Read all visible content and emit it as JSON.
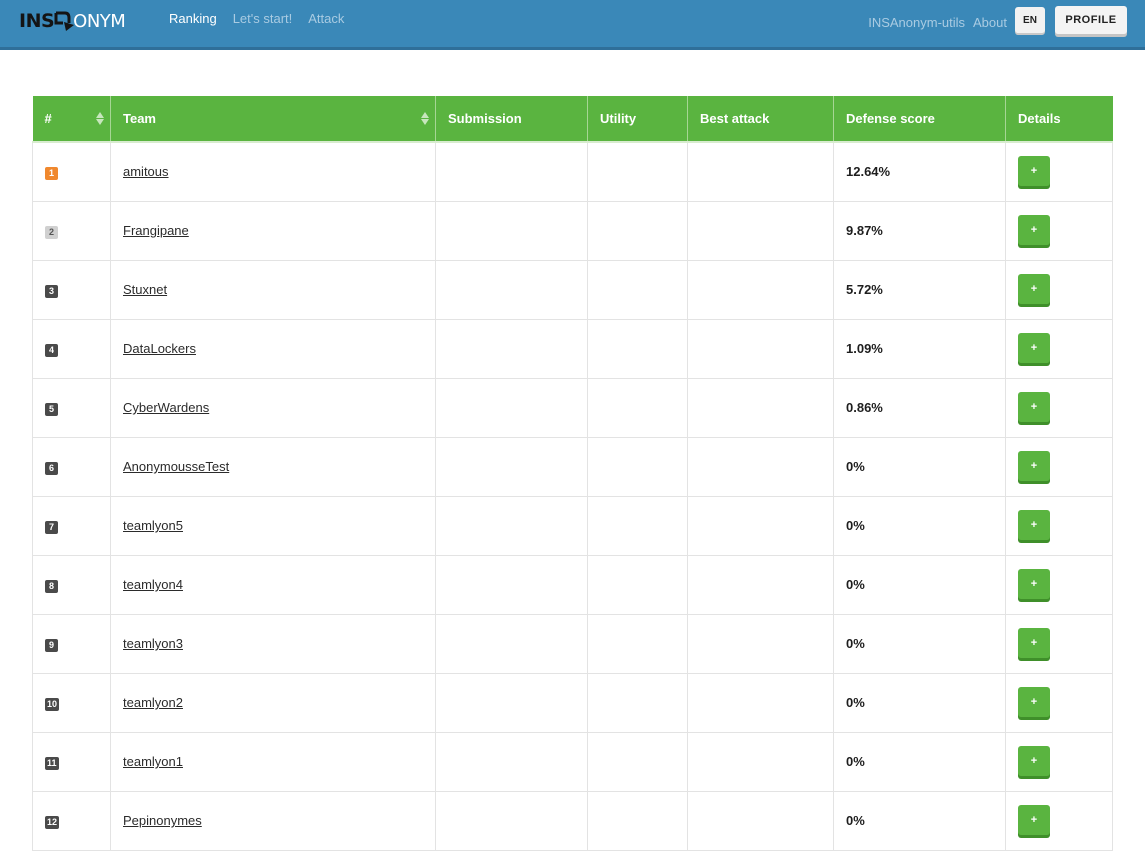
{
  "colors": {
    "navbar": "#3a88b8",
    "header_green": "#5ab440",
    "badge_gold": "#f0882e",
    "badge_silver": "#d0d0d0",
    "badge_dark": "#4a4a4a"
  },
  "brand": {
    "part1": "INS",
    "part2": "ONYM",
    "logo_icon": "arrow-logo-icon"
  },
  "nav": {
    "ranking": "Ranking",
    "lets_start": "Let's start!",
    "attack": "Attack",
    "utils": "INSAnonym-utils",
    "about": "About",
    "lang": "EN",
    "profile": "PROFILE"
  },
  "table": {
    "headers": {
      "rank": "#",
      "team": "Team",
      "submission": "Submission",
      "utility": "Utility",
      "best_attack": "Best attack",
      "defense_score": "Defense score",
      "details": "Details"
    },
    "details_button_label": "+",
    "rows": [
      {
        "rank": "1",
        "team": "amitous",
        "submission": "",
        "utility": "",
        "best_attack": "",
        "defense_score": "12.64%",
        "badge": "gold"
      },
      {
        "rank": "2",
        "team": "Frangipane",
        "submission": "",
        "utility": "",
        "best_attack": "",
        "defense_score": "9.87%",
        "badge": "silver"
      },
      {
        "rank": "3",
        "team": "Stuxnet",
        "submission": "",
        "utility": "",
        "best_attack": "",
        "defense_score": "5.72%",
        "badge": "dark"
      },
      {
        "rank": "4",
        "team": "DataLockers",
        "submission": "",
        "utility": "",
        "best_attack": "",
        "defense_score": "1.09%",
        "badge": "dark"
      },
      {
        "rank": "5",
        "team": "CyberWardens",
        "submission": "",
        "utility": "",
        "best_attack": "",
        "defense_score": "0.86%",
        "badge": "dark"
      },
      {
        "rank": "6",
        "team": "AnonymousseTest",
        "submission": "",
        "utility": "",
        "best_attack": "",
        "defense_score": "0%",
        "badge": "dark"
      },
      {
        "rank": "7",
        "team": "teamlyon5",
        "submission": "",
        "utility": "",
        "best_attack": "",
        "defense_score": "0%",
        "badge": "dark"
      },
      {
        "rank": "8",
        "team": "teamlyon4",
        "submission": "",
        "utility": "",
        "best_attack": "",
        "defense_score": "0%",
        "badge": "dark"
      },
      {
        "rank": "9",
        "team": "teamlyon3",
        "submission": "",
        "utility": "",
        "best_attack": "",
        "defense_score": "0%",
        "badge": "dark"
      },
      {
        "rank": "10",
        "team": "teamlyon2",
        "submission": "",
        "utility": "",
        "best_attack": "",
        "defense_score": "0%",
        "badge": "dark"
      },
      {
        "rank": "11",
        "team": "teamlyon1",
        "submission": "",
        "utility": "",
        "best_attack": "",
        "defense_score": "0%",
        "badge": "dark"
      },
      {
        "rank": "12",
        "team": "Pepinonymes",
        "submission": "",
        "utility": "",
        "best_attack": "",
        "defense_score": "0%",
        "badge": "dark"
      }
    ]
  }
}
